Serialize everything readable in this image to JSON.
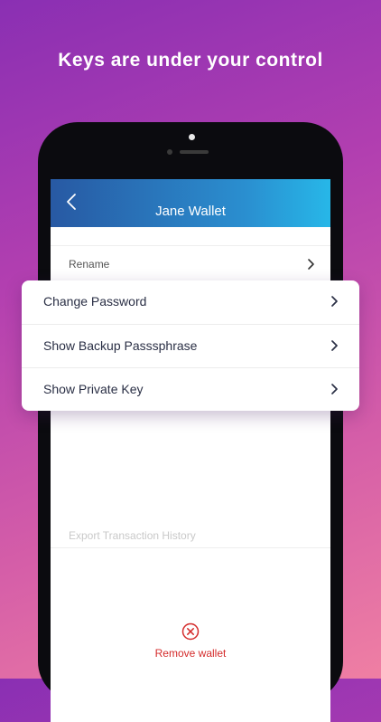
{
  "headline": "Keys are under your control",
  "nav": {
    "title": "Jane Wallet"
  },
  "rows": [
    {
      "label": "Rename"
    },
    {
      "label": "Export Transaction History"
    }
  ],
  "popup": {
    "items": [
      {
        "label": "Change Password"
      },
      {
        "label": "Show Backup Passsphrase"
      },
      {
        "label": "Show Private Key"
      }
    ]
  },
  "remove_label": "Remove wallet",
  "colors": {
    "accent": "#2a8fd0",
    "danger": "#d42b2b"
  }
}
